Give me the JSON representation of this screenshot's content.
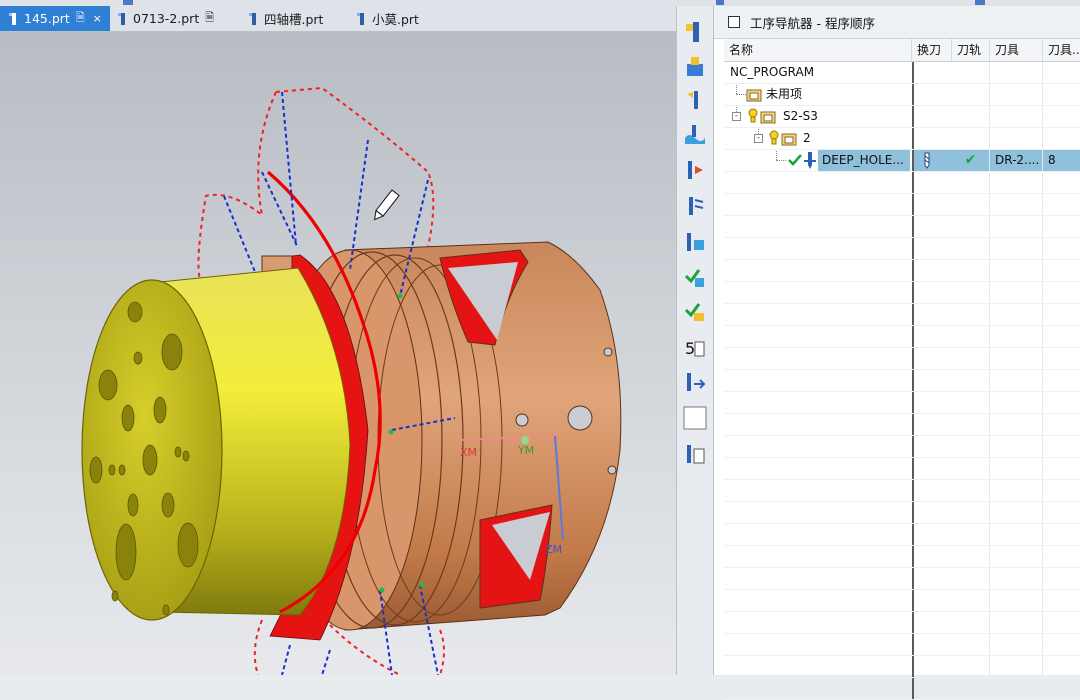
{
  "tabs": [
    {
      "label": "145.prt",
      "active": true,
      "modified": true,
      "closable": true
    },
    {
      "label": "0713-2.prt",
      "active": false,
      "modified": true,
      "closable": false
    },
    {
      "label": "四轴槽.prt",
      "active": false,
      "modified": false,
      "closable": false
    },
    {
      "label": "小莫.prt",
      "active": false,
      "modified": false,
      "closable": false
    }
  ],
  "tab_icons": {
    "modified": "page-edit-icon",
    "close": "×",
    "part": "part-file-icon"
  },
  "navigator": {
    "title": "工序导航器 - 程序顺序",
    "columns": [
      "名称",
      "换刀",
      "刀轨",
      "刀具",
      "刀具..."
    ],
    "rows": [
      {
        "name": "NC_PROGRAM",
        "level": 0,
        "icon": "none",
        "tool_change": "",
        "path": "",
        "tool": "",
        "tool_num": "",
        "selected": false
      },
      {
        "name": "未用项",
        "level": 1,
        "icon": "program-group-icon",
        "tool_change": "",
        "path": "",
        "tool": "",
        "tool_num": "",
        "selected": false
      },
      {
        "name": "S2-S3",
        "level": 1,
        "icon": "program-group-icon",
        "tool_change": "",
        "path": "",
        "tool": "",
        "tool_num": "",
        "selected": false
      },
      {
        "name": "2",
        "level": 2,
        "icon": "program-group-icon",
        "tool_change": "",
        "path": "",
        "tool": "",
        "tool_num": "",
        "selected": false
      },
      {
        "name": "DEEP_HOLE...",
        "level": 3,
        "icon": "drill-operation-icon",
        "tool_change": "drill-bit-icon",
        "path": "✔",
        "tool": "DR-2....",
        "tool_num": "8",
        "selected": true
      }
    ]
  },
  "viewport": {
    "axis_labels": {
      "xm": "XM",
      "ym": "YM",
      "zm": "ZM"
    }
  },
  "resource_bar_icons": [
    "create-program-icon",
    "create-tool-icon",
    "create-geometry-icon",
    "create-method-icon",
    "create-operation-icon",
    "generate-toolpath-icon",
    "replay-toolpath-icon",
    "verify-toolpath-icon",
    "verify-3d-icon",
    "post-process-icon",
    "list-toolpath-icon",
    "blank-square-icon",
    "shop-doc-icon"
  ],
  "colors": {
    "selection": "#8fc0dc",
    "tab_active": "#2f7fd4",
    "check_green": "#1aa33a"
  }
}
